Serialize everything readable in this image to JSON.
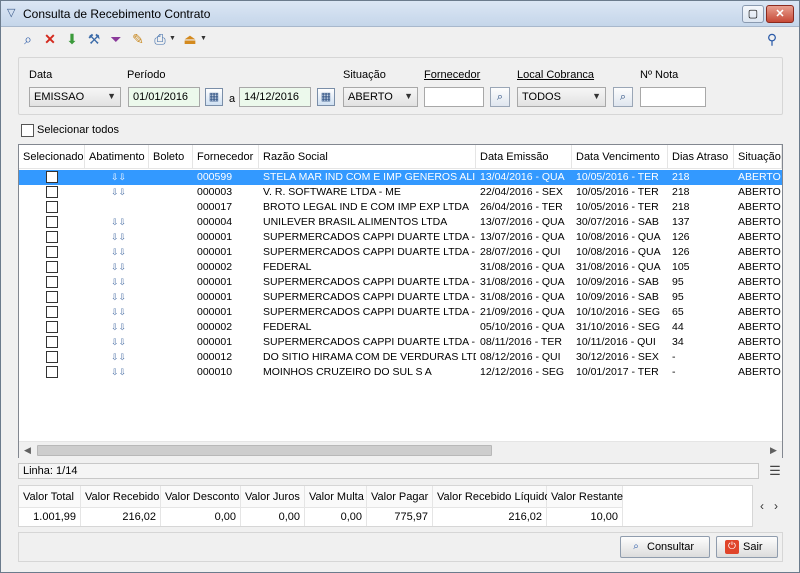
{
  "window": {
    "title": "Consulta de Recebimento Contrato"
  },
  "toolbar": {
    "icons": [
      "new-query-icon",
      "delete-icon",
      "import-icon",
      "tools-icon",
      "filter-icon",
      "edit-icon",
      "print-icon",
      "export-icon",
      "search-icon"
    ]
  },
  "filters": {
    "data_label": "Data",
    "data_value": "EMISSAO",
    "periodo_label": "Período",
    "periodo_start": "01/01/2016",
    "periodo_sep": "a",
    "periodo_end": "14/12/2016",
    "situacao_label": "Situação",
    "situacao_value": "ABERTO",
    "fornecedor_label": "Fornecedor",
    "fornecedor_value": "",
    "local_label": "Local Cobranca",
    "local_value": "TODOS",
    "nota_label": "Nº Nota",
    "nota_value": ""
  },
  "select_all_label": "Selecionar todos",
  "grid": {
    "columns": [
      "Selecionado",
      "Abatimento",
      "Boleto",
      "Fornecedor",
      "Razão Social",
      "Data Emissão",
      "Data Vencimento",
      "Dias Atraso",
      "Situação"
    ],
    "rows": [
      {
        "abat": true,
        "forn": "000599",
        "razao": "STELA MAR IND COM E IMP GENEROS ALIM L",
        "emissao": "13/04/2016 - QUA",
        "venc": "10/05/2016 - TER",
        "dias": "218",
        "sit": "ABERTO",
        "selected": true
      },
      {
        "abat": true,
        "forn": "000003",
        "razao": "V. R. SOFTWARE LTDA - ME",
        "emissao": "22/04/2016 - SEX",
        "venc": "10/05/2016 - TER",
        "dias": "218",
        "sit": "ABERTO"
      },
      {
        "abat": false,
        "forn": "000017",
        "razao": "BROTO LEGAL IND E COM IMP EXP LTDA",
        "emissao": "26/04/2016 - TER",
        "venc": "10/05/2016 - TER",
        "dias": "218",
        "sit": "ABERTO"
      },
      {
        "abat": true,
        "forn": "000004",
        "razao": "UNILEVER BRASIL ALIMENTOS LTDA",
        "emissao": "13/07/2016 - QUA",
        "venc": "30/07/2016 - SAB",
        "dias": "137",
        "sit": "ABERTO"
      },
      {
        "abat": true,
        "forn": "000001",
        "razao": "SUPERMERCADOS CAPPI DUARTE LTDA - ME",
        "emissao": "13/07/2016 - QUA",
        "venc": "10/08/2016 - QUA",
        "dias": "126",
        "sit": "ABERTO"
      },
      {
        "abat": true,
        "forn": "000001",
        "razao": "SUPERMERCADOS CAPPI DUARTE LTDA - ME",
        "emissao": "28/07/2016 - QUI",
        "venc": "10/08/2016 - QUA",
        "dias": "126",
        "sit": "ABERTO"
      },
      {
        "abat": true,
        "forn": "000002",
        "razao": "FEDERAL",
        "emissao": "31/08/2016 - QUA",
        "venc": "31/08/2016 - QUA",
        "dias": "105",
        "sit": "ABERTO"
      },
      {
        "abat": true,
        "forn": "000001",
        "razao": "SUPERMERCADOS CAPPI DUARTE LTDA - ME",
        "emissao": "31/08/2016 - QUA",
        "venc": "10/09/2016 - SAB",
        "dias": "95",
        "sit": "ABERTO"
      },
      {
        "abat": true,
        "forn": "000001",
        "razao": "SUPERMERCADOS CAPPI DUARTE LTDA - ME",
        "emissao": "31/08/2016 - QUA",
        "venc": "10/09/2016 - SAB",
        "dias": "95",
        "sit": "ABERTO"
      },
      {
        "abat": true,
        "forn": "000001",
        "razao": "SUPERMERCADOS CAPPI DUARTE LTDA - ME",
        "emissao": "21/09/2016 - QUA",
        "venc": "10/10/2016 - SEG",
        "dias": "65",
        "sit": "ABERTO"
      },
      {
        "abat": true,
        "forn": "000002",
        "razao": "FEDERAL",
        "emissao": "05/10/2016 - QUA",
        "venc": "31/10/2016 - SEG",
        "dias": "44",
        "sit": "ABERTO"
      },
      {
        "abat": true,
        "forn": "000001",
        "razao": "SUPERMERCADOS CAPPI DUARTE LTDA - ME",
        "emissao": "08/11/2016 - TER",
        "venc": "10/11/2016 - QUI",
        "dias": "34",
        "sit": "ABERTO"
      },
      {
        "abat": true,
        "forn": "000012",
        "razao": "DO SITIO HIRAMA COM DE VERDURAS LTDA",
        "emissao": "08/12/2016 - QUI",
        "venc": "30/12/2016 - SEX",
        "dias": "-",
        "sit": "ABERTO"
      },
      {
        "abat": true,
        "forn": "000010",
        "razao": "MOINHOS CRUZEIRO DO SUL S A",
        "emissao": "12/12/2016 - SEG",
        "venc": "10/01/2017 - TER",
        "dias": "-",
        "sit": "ABERTO"
      }
    ]
  },
  "status": {
    "linha": "Linha: 1/14"
  },
  "totals": [
    {
      "label": "Valor Total",
      "value": "1.001,99"
    },
    {
      "label": "Valor Recebido",
      "value": "216,02"
    },
    {
      "label": "Valor Desconto",
      "value": "0,00"
    },
    {
      "label": "Valor Juros",
      "value": "0,00"
    },
    {
      "label": "Valor Multa",
      "value": "0,00"
    },
    {
      "label": "Valor Pagar",
      "value": "775,97"
    },
    {
      "label": "Valor Recebido Líquido",
      "value": "216,02"
    },
    {
      "label": "Valor Restante",
      "value": "10,00"
    }
  ],
  "buttons": {
    "consultar": "Consultar",
    "sair": "Sair"
  },
  "colors": {
    "selection": "#3399ff",
    "period_bg": "#ecf9ec",
    "sair_icon": "#e0442a"
  }
}
